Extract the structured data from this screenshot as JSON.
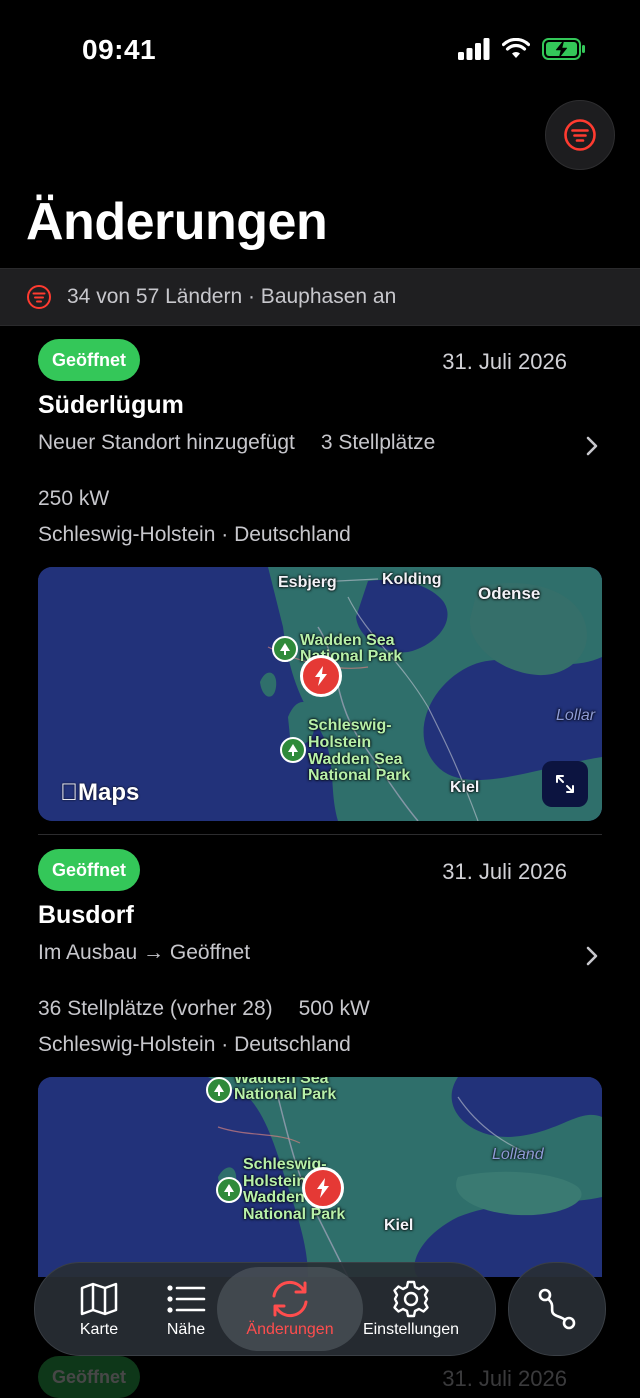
{
  "status": {
    "time": "09:41"
  },
  "header": {
    "title": "Änderungen"
  },
  "filter_summary": "34 von 57 Ländern · Bauphasen an",
  "entries": [
    {
      "status": "Geöffnet",
      "date": "31. Juli 2026",
      "name": "Süderlügum",
      "change": "Neuer Standort hinzugefügt",
      "change_extra": "3 Stellplätze",
      "detail_a": "250 kW",
      "detail_b": "",
      "region": "Schleswig-Holstein · Deutschland",
      "map_labels": {
        "esbjerg": "Esbjerg",
        "kolding": "Kolding",
        "odense": "Odense",
        "wadden1": "Wadden Sea",
        "wadden2": "National Park",
        "sh1": "Schleswig-",
        "sh2": "Holstein",
        "sh3": "Wadden Sea",
        "sh4": "National Park",
        "kiel": "Kiel",
        "lolland": "Lollar"
      },
      "maps_brand": "Maps"
    },
    {
      "status": "Geöffnet",
      "date": "31. Juli 2026",
      "name": "Busdorf",
      "change": "Im Ausbau → Geöffnet",
      "change_extra": "",
      "detail_a": "36 Stellplätze (vorher 28)",
      "detail_b": "500 kW",
      "region": "Schleswig-Holstein · Deutschland",
      "map_labels": {
        "wadden1": "Wadden Sea",
        "wadden2": "National Park",
        "sh1": "Schleswig-",
        "sh2": "Holstein",
        "sh3": "Wadden",
        "sh4": "National Park",
        "kiel": "Kiel",
        "lolland": "Lolland"
      }
    }
  ],
  "ghost_entry": {
    "status": "Geöffnet",
    "date": "31. Juli 2026"
  },
  "tabs": [
    {
      "label": "Karte",
      "icon": "map-icon"
    },
    {
      "label": "Nähe",
      "icon": "list-icon"
    },
    {
      "label": "Änderungen",
      "icon": "sync-icon",
      "active": true
    },
    {
      "label": "Einstellungen",
      "icon": "gear-icon"
    }
  ],
  "colors": {
    "accent": "#ff4d4d",
    "open_badge": "#34c759",
    "background": "#000000"
  }
}
